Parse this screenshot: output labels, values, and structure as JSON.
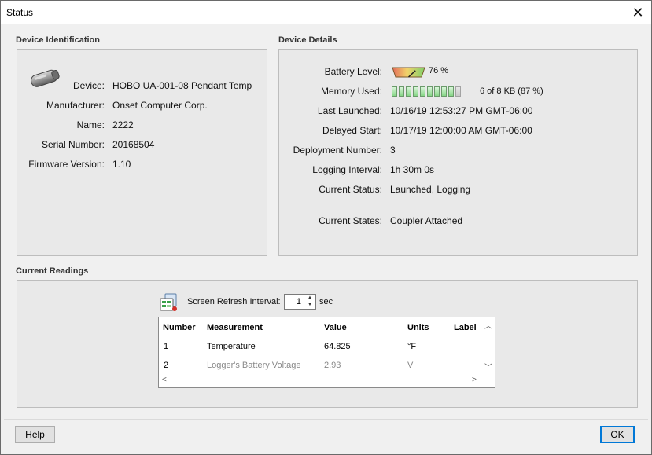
{
  "window": {
    "title": "Status",
    "close_glyph": "✕"
  },
  "device_identification": {
    "title": "Device Identification",
    "icon": "logger-device-icon",
    "fields": [
      {
        "label": "Device:",
        "value": "HOBO UA-001-08 Pendant Temp"
      },
      {
        "label": "Manufacturer:",
        "value": "Onset Computer Corp."
      },
      {
        "label": "Name:",
        "value": "2222"
      },
      {
        "label": "Serial Number:",
        "value": "20168504"
      },
      {
        "label": "Firmware Version:",
        "value": "1.10"
      }
    ]
  },
  "device_details": {
    "title": "Device Details",
    "battery": {
      "label": "Battery Level:",
      "value": "76 %",
      "level": 0.76
    },
    "memory": {
      "label": "Memory Used:",
      "value": "6 of 8 KB (87 %)",
      "filled_bars": 9,
      "total_bars": 10
    },
    "fields": [
      {
        "label": "Last Launched:",
        "value": "10/16/19 12:53:27 PM GMT-06:00"
      },
      {
        "label": "Delayed Start:",
        "value": "10/17/19 12:00:00 AM GMT-06:00"
      },
      {
        "label": "Deployment Number:",
        "value": "3"
      },
      {
        "label": "Logging Interval:",
        "value": "1h 30m 0s"
      },
      {
        "label": "Current Status:",
        "value": "Launched, Logging"
      }
    ],
    "states": {
      "label": "Current States:",
      "value": "Coupler Attached"
    }
  },
  "current_readings": {
    "title": "Current Readings",
    "refresh": {
      "label": "Screen Refresh Interval:",
      "value": "1",
      "unit": "sec"
    },
    "table": {
      "headers": [
        "Number",
        "Measurement",
        "Value",
        "Units",
        "Label"
      ],
      "rows": [
        {
          "number": "1",
          "measurement": "Temperature",
          "value": "64.825",
          "units": "°F",
          "label": "",
          "dimmed": false
        },
        {
          "number": "2",
          "measurement": "Logger's Battery Voltage",
          "value": "2.93",
          "units": "V",
          "label": "",
          "dimmed": true
        }
      ]
    }
  },
  "buttons": {
    "help": "Help",
    "ok": "OK"
  }
}
